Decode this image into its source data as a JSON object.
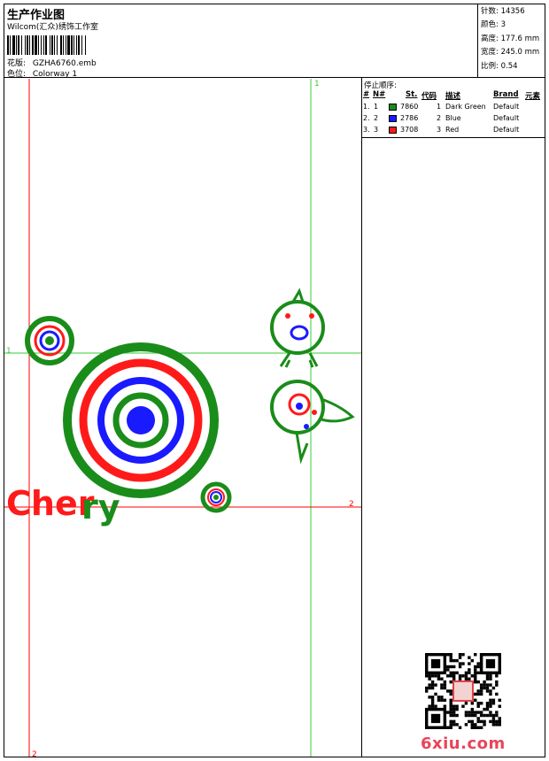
{
  "header": {
    "title": "生产作业图",
    "studio": "Wilcom(汇众)绣饰工作室",
    "pattern_label": "花版:",
    "pattern_value": "GZHA6760.emb",
    "color_label": "色位:",
    "color_value": "Colorway 1"
  },
  "stats": [
    {
      "label": "针数:",
      "value": "14356"
    },
    {
      "label": "颜色:",
      "value": "3"
    },
    {
      "label": "高度:",
      "value": "177.6 mm"
    },
    {
      "label": "宽度:",
      "value": "245.0 mm"
    },
    {
      "label": "比例:",
      "value": "0.54"
    }
  ],
  "stop_sequence": {
    "title": "停止顺序:",
    "columns": [
      "#",
      "N#",
      "St.",
      "代码",
      "描述",
      "Brand",
      "元素"
    ],
    "rows": [
      {
        "num": "1.",
        "n": "1",
        "color": "#1a8c1a",
        "st": "7860",
        "code": "1",
        "desc": "Dark Green",
        "brand": "Default"
      },
      {
        "num": "2.",
        "n": "2",
        "color": "#1a1aff",
        "st": "2786",
        "code": "2",
        "desc": "Blue",
        "brand": "Default"
      },
      {
        "num": "3.",
        "n": "3",
        "color": "#ff1a1a",
        "st": "3708",
        "code": "3",
        "desc": "Red",
        "brand": "Default"
      }
    ]
  },
  "design": {
    "guide_labels": {
      "top_v": "1",
      "left_h": "1",
      "right_h": "2",
      "bottom_v": "2"
    },
    "text": "Cherry"
  },
  "watermark": "6xiu.com",
  "colors": {
    "green": "#1a8c1a",
    "blue": "#1a1aff",
    "red": "#ff1a1a",
    "guide_green": "#33cc33",
    "guide_red": "#ff0000"
  }
}
